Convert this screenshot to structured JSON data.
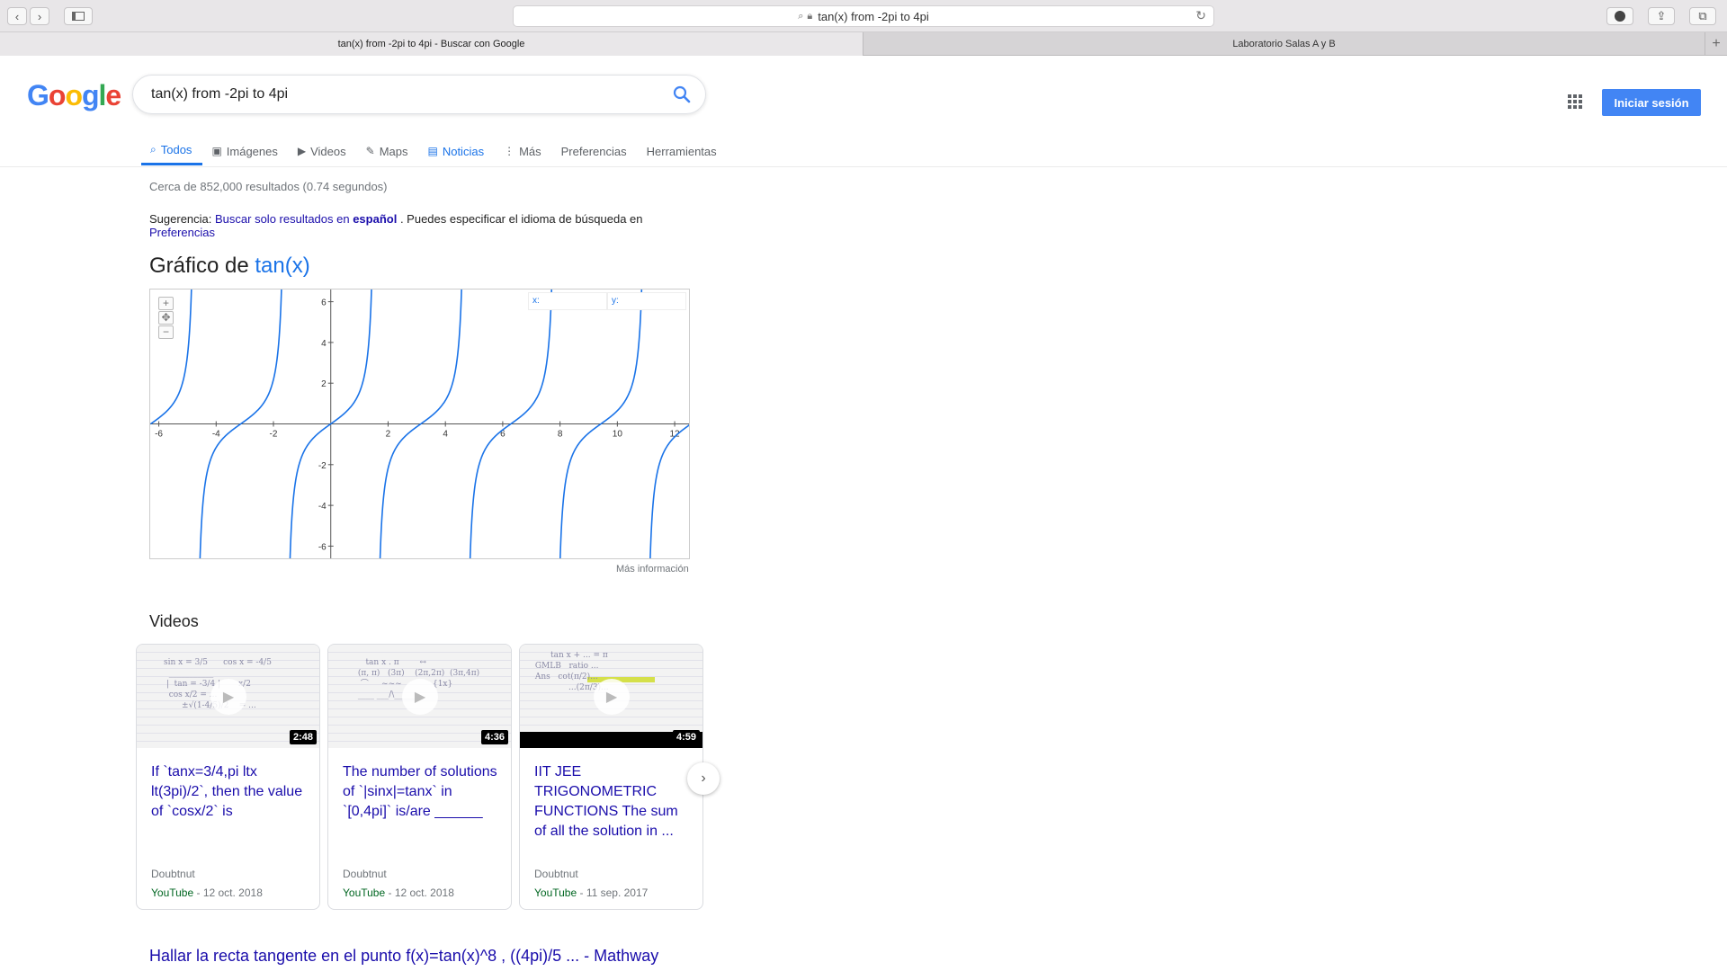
{
  "browser": {
    "url": "tan(x) from -2pi to 4pi",
    "tabs": [
      {
        "label": "tan(x) from -2pi to 4pi - Buscar con Google"
      },
      {
        "label": "Laboratorio Salas A y B"
      }
    ]
  },
  "header": {
    "logo_text": "Google",
    "query": "tan(x) from -2pi to 4pi",
    "signin_label": "Iniciar sesión"
  },
  "nav": {
    "tabs": [
      {
        "label": "Todos",
        "icon": "search-icon"
      },
      {
        "label": "Imágenes",
        "icon": "image-icon"
      },
      {
        "label": "Videos",
        "icon": "video-icon"
      },
      {
        "label": "Maps",
        "icon": "map-icon"
      },
      {
        "label": "Noticias",
        "icon": "news-icon"
      },
      {
        "label": "Más",
        "icon": "more-icon"
      },
      {
        "label": "Preferencias"
      },
      {
        "label": "Herramientas"
      }
    ]
  },
  "stats": "Cerca de 852,000 resultados (0.74 segundos)",
  "suggestion": {
    "prefix": "Sugerencia: ",
    "link_text": "Buscar solo resultados en ",
    "link_bold": "español",
    "middle": " . Puedes especificar el idioma de búsqueda en ",
    "pref_link": "Preferencias"
  },
  "graph": {
    "title_prefix": "Gráfico de ",
    "function": "tan(x)",
    "x_label": "x:",
    "y_label": "y:",
    "more_info": "Más información",
    "zoom_in": "+",
    "zoom_out": "−",
    "pan": "✥"
  },
  "chart_data": {
    "type": "line",
    "series": [
      {
        "name": "tan(x)",
        "function": "tan(x)",
        "x_range": [
          -6.2832,
          12.5664
        ]
      }
    ],
    "xlim": [
      -6.3,
      12.5
    ],
    "ylim": [
      -6.6,
      6.6
    ],
    "x_ticks": [
      -6,
      -4,
      -2,
      2,
      4,
      6,
      8,
      10,
      12
    ],
    "y_ticks": [
      6,
      4,
      2,
      -2,
      -4,
      -6
    ],
    "color": "#1a73e8",
    "grid": false
  },
  "videos": {
    "section_title": "Videos",
    "items": [
      {
        "title": "If `tanx=3/4,pi ltx lt(3pi)/2`, then the value of `cosx/2` is",
        "duration": "2:48",
        "source": "Doubtnut",
        "platform": "YouTube",
        "date": " - 12 oct. 2018"
      },
      {
        "title": "The number of solutions of `|sinx|=tanx` in `[0,4pi]` is/are ______",
        "duration": "4:36",
        "source": "Doubtnut",
        "platform": "YouTube",
        "date": " - 12 oct. 2018"
      },
      {
        "title": "IIT JEE TRIGONOMETRIC FUNCTIONS The sum of all the solution in ...",
        "duration": "4:59",
        "source": "Doubtnut",
        "platform": "YouTube",
        "date": " - 11 sep. 2017"
      }
    ]
  },
  "result": {
    "title": "Hallar la recta tangente en el punto f(x)=tan(x)^8 , ((4pi)/5 ... - Mathway"
  }
}
